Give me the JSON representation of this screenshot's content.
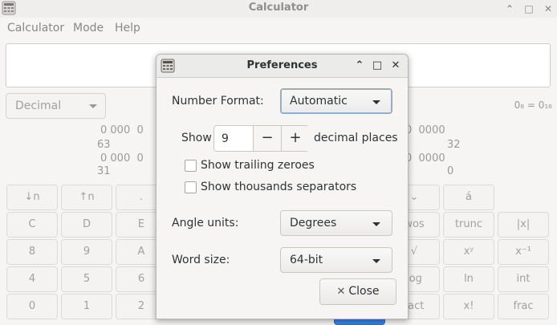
{
  "window": {
    "title": "Calculator",
    "controls": {
      "minimize": "⌃",
      "maximize": "□",
      "close": "✕"
    }
  },
  "menu": [
    "Calculator",
    "Mode",
    "Help"
  ],
  "mode_dropdown": {
    "value": "Decimal"
  },
  "base_label": "0₈ = 0₁₆",
  "bit_display": {
    "left": [
      "0 000  0",
      "63",
      "0 000  0",
      "31"
    ],
    "right": [
      "0  0000",
      "32",
      "0  0000",
      "0"
    ]
  },
  "keypad": {
    "row0": [
      "↓n",
      "↑n",
      "."
    ],
    "row0_right": [
      "⌄",
      "á"
    ],
    "row1": [
      "C",
      "D",
      "E"
    ],
    "row1_right": [
      "wos",
      "trunc",
      "|x|"
    ],
    "row2": [
      "8",
      "9",
      "A"
    ],
    "row2_right": [
      "√",
      "xʸ",
      "x⁻¹"
    ],
    "row3": [
      "4",
      "5",
      "6"
    ],
    "row3_right": [
      "log",
      "ln",
      "int"
    ],
    "row4": [
      "0",
      "1",
      "2"
    ],
    "row4_right": [
      "fact",
      "x!",
      "frac"
    ]
  },
  "dialog": {
    "title": "Preferences",
    "controls": {
      "minimize": "⌃",
      "maximize": "□",
      "close": "✕"
    },
    "number_format_label": "Number Format:",
    "number_format_value": "Automatic",
    "show_label": "Show",
    "decimal_places_value": "9",
    "decimal_minus": "−",
    "decimal_plus": "+",
    "decimal_places_suffix": "decimal places",
    "show_trailing_zeroes": {
      "label": "Show trailing zeroes",
      "checked": false
    },
    "show_thousands_separators": {
      "label": "Show thousands separators",
      "checked": false
    },
    "angle_units_label": "Angle units:",
    "angle_units_value": "Degrees",
    "word_size_label": "Word size:",
    "word_size_value": "64-bit",
    "close_label": "Close",
    "close_icon": "✕"
  }
}
